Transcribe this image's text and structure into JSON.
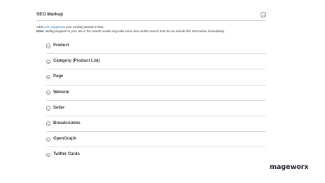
{
  "section": {
    "title": "SEO Markup"
  },
  "description": {
    "line1_prefix": "Adds ",
    "line1_link": "rich snippets",
    "line1_suffix": " to your existing website HTML.",
    "note_label": "Note:",
    "note_text": " adding snippets to your site in the search results may take some time as the search bots do not include this information immediately."
  },
  "items": [
    {
      "label": "Product",
      "icon": "chevron-down-icon"
    },
    {
      "label": "Category (Product List)",
      "icon": "chevron-down-icon"
    },
    {
      "label": "Page",
      "icon": "chevron-down-icon"
    },
    {
      "label": "Website",
      "icon": "chevron-down-icon"
    },
    {
      "label": "Seller",
      "icon": "chevron-down-icon"
    },
    {
      "label": "Breadcrumbs",
      "icon": "chevron-down-icon"
    },
    {
      "label": "OpenGraph",
      "icon": "chevron-down-icon"
    },
    {
      "label": "Twitter Cards",
      "icon": "chevron-down-icon"
    }
  ],
  "logo": {
    "text": "mageworx"
  },
  "colors": {
    "link": "#1979c3",
    "text": "#303030",
    "icon_stroke": "#8a8a8a",
    "divider": "#dadada"
  }
}
